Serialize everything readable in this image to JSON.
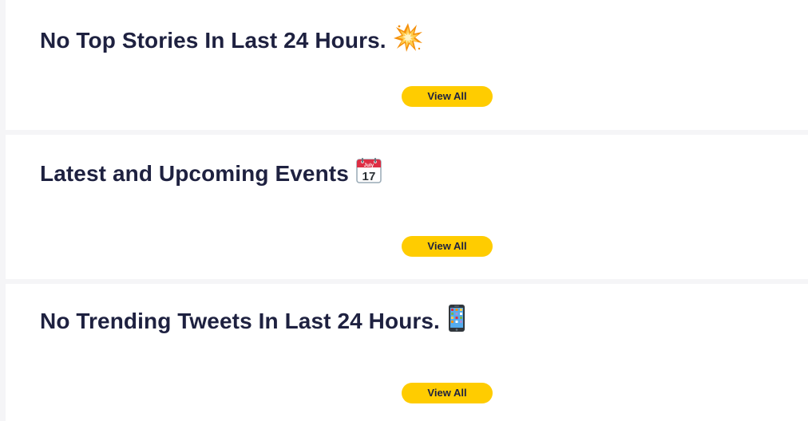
{
  "sections": [
    {
      "title": "No Top Stories In Last 24 Hours.",
      "icon": "collision-icon",
      "button_label": "View All"
    },
    {
      "title": "Latest and Upcoming Events",
      "icon": "calendar-icon",
      "icon_text_month": "July",
      "icon_text_day": "17",
      "button_label": "View All"
    },
    {
      "title": "No Trending Tweets In Last 24 Hours.",
      "icon": "mobile-phone-icon",
      "button_label": "View All"
    }
  ],
  "colors": {
    "title": "#1e2140",
    "button_bg": "#ffcc00",
    "page_bg": "#f5f5f7",
    "card_bg": "#ffffff"
  }
}
